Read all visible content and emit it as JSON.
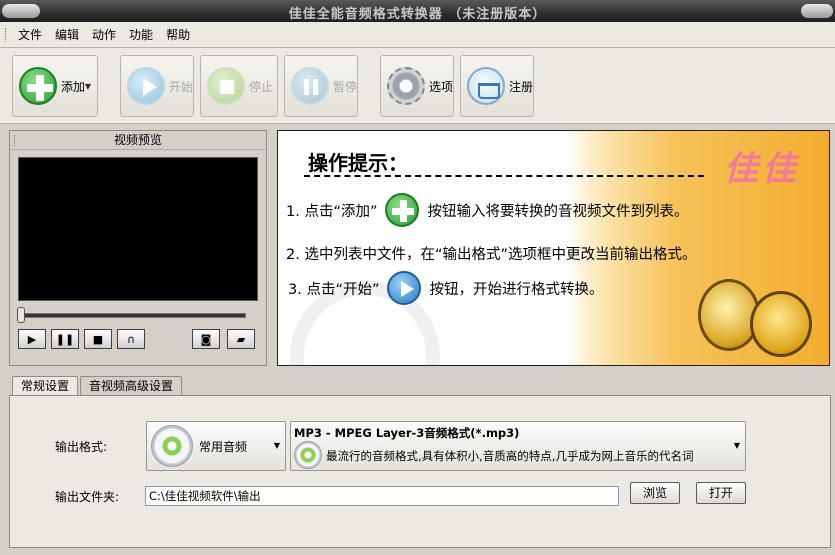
{
  "window": {
    "title": "佳佳全能音频格式转换器  （未注册版本）"
  },
  "menu": [
    "文件",
    "编辑",
    "动作",
    "功能",
    "帮助"
  ],
  "toolbar": {
    "add": "添加",
    "start": "开始",
    "stop": "停止",
    "pause": "暂停",
    "options": "选项",
    "register": "注册"
  },
  "preview": {
    "title": "视频预览"
  },
  "tips": {
    "heading": "操作提示：",
    "brand": "佳佳",
    "step1_pre": "1. 点击“添加”",
    "step1_post": "按钮输入将要转换的音视频文件到列表。",
    "step2": "2. 选中列表中文件，在“输出格式”选项框中更改当前输出格式。",
    "step3_pre": "3. 点击“开始”",
    "step3_post": "按钮，开始进行格式转换。"
  },
  "tabs": [
    "常规设置",
    "音视频高级设置"
  ],
  "settings": {
    "output_format_label": "输出格式:",
    "category": "常用音频",
    "format_name": "MP3 - MPEG Layer-3音频格式(*.mp3)",
    "format_desc": "最流行的音频格式,具有体积小,音质高的特点,几乎成为网上音乐的代名词",
    "output_folder_label": "输出文件夹:",
    "output_folder": "C:\\佳佳视频软件\\输出",
    "browse": "浏览",
    "open": "打开"
  }
}
